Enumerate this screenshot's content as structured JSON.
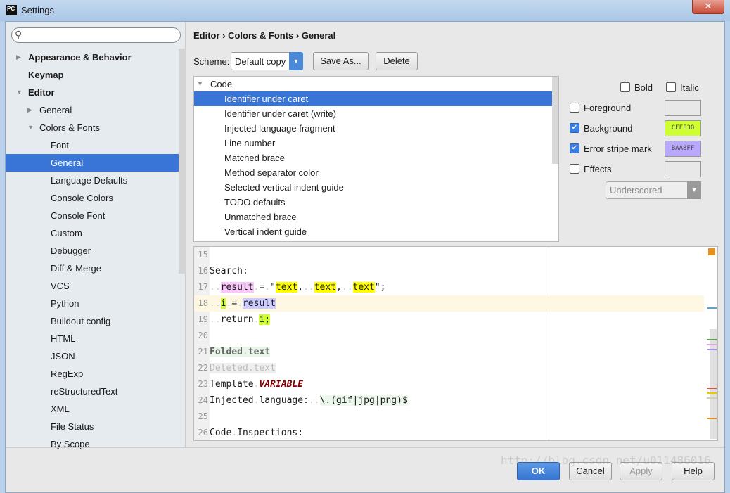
{
  "window": {
    "title": "Settings",
    "logo": "PC",
    "close": "✕"
  },
  "search": {
    "placeholder": "",
    "icon": "search-icon"
  },
  "tree": [
    {
      "label": "Appearance & Behavior",
      "level": 0,
      "bold": true,
      "arrow": "▶"
    },
    {
      "label": "Keymap",
      "level": 0,
      "bold": true,
      "arrow": ""
    },
    {
      "label": "Editor",
      "level": 0,
      "bold": true,
      "arrow": "▼"
    },
    {
      "label": "General",
      "level": 1,
      "arrow": "▶"
    },
    {
      "label": "Colors & Fonts",
      "level": 1,
      "arrow": "▼"
    },
    {
      "label": "Font",
      "level": 2
    },
    {
      "label": "General",
      "level": 2,
      "selected": true
    },
    {
      "label": "Language Defaults",
      "level": 2
    },
    {
      "label": "Console Colors",
      "level": 2
    },
    {
      "label": "Console Font",
      "level": 2
    },
    {
      "label": "Custom",
      "level": 2
    },
    {
      "label": "Debugger",
      "level": 2
    },
    {
      "label": "Diff & Merge",
      "level": 2
    },
    {
      "label": "VCS",
      "level": 2
    },
    {
      "label": "Python",
      "level": 2
    },
    {
      "label": "Buildout config",
      "level": 2
    },
    {
      "label": "HTML",
      "level": 2
    },
    {
      "label": "JSON",
      "level": 2
    },
    {
      "label": "RegExp",
      "level": 2
    },
    {
      "label": "reStructuredText",
      "level": 2
    },
    {
      "label": "XML",
      "level": 2
    },
    {
      "label": "File Status",
      "level": 2
    },
    {
      "label": "By Scope",
      "level": 2
    }
  ],
  "breadcrumb": "Editor › Colors & Fonts › General",
  "scheme": {
    "label": "Scheme:",
    "value": "Default copy",
    "save_as": "Save As...",
    "delete": "Delete"
  },
  "list": {
    "group": "Code",
    "items": [
      "Identifier under caret",
      "Identifier under caret (write)",
      "Injected language fragment",
      "Line number",
      "Matched brace",
      "Method separator color",
      "Selected vertical indent guide",
      "TODO defaults",
      "Unmatched brace",
      "Vertical indent guide"
    ],
    "selected": 0
  },
  "attrs": {
    "bold": "Bold",
    "italic": "Italic",
    "foreground": "Foreground",
    "background": "Background",
    "background_value": "CEFF30",
    "background_checked": true,
    "error_stripe": "Error stripe mark",
    "error_stripe_value": "BAA8FF",
    "error_stripe_checked": true,
    "effects": "Effects",
    "effect_type": "Underscored"
  },
  "editor": {
    "lines": [
      {
        "n": "15",
        "html": ""
      },
      {
        "n": "16",
        "html": "Search:"
      },
      {
        "n": "17",
        "html": "<span class=d>..</span><span style='background:#f8c8f8'>result</span><span class=d>.</span>=<span class=d>.</span>\"<span style='background:#ff0'>text</span>,<span class=d>..</span><span style='background:#ff0'>text</span>,<span class=d>..</span><span style='background:#ff0'>text</span>\";"
      },
      {
        "n": "18",
        "html": "<span class=d>..</span><span style='background:#ceff30'>i</span><span class=d>.</span>=<span class=d>.</span><span style='background:#ccccff'>result</span>",
        "cur": true
      },
      {
        "n": "19",
        "html": "<span class=d>..</span>return<span class=d>.</span><span style='background:#ceff30'>i;</span>"
      },
      {
        "n": "20",
        "html": ""
      },
      {
        "n": "21",
        "html": "<b style='background:#e8f5e8;color:#666'>Folded<span class=d>.</span>text</b>"
      },
      {
        "n": "22",
        "html": "<span style='background:#efefef;color:#bbb'>Deleted.text</span>"
      },
      {
        "n": "23",
        "html": "Template<span class=d>.</span><b><i style='color:#800000'>VARIABLE</i></b>"
      },
      {
        "n": "24",
        "html": "Injected<span class=d>.</span>language:<span class=d>..</span><span style='background:#edf8ec'>\\.(gif|jpg|png)$</span>"
      },
      {
        "n": "25",
        "html": ""
      },
      {
        "n": "26",
        "html": "Code<span class=d>.</span>Inspections:"
      }
    ]
  },
  "stripes": [
    "#e8901a",
    "#4da6dd",
    "#5a9e4a",
    "#e8a0e8",
    "#a090e8",
    "#d05050",
    "#e8c800",
    "#d8ccaa",
    "#e08a1a"
  ],
  "footer": {
    "ok": "OK",
    "cancel": "Cancel",
    "apply": "Apply",
    "help": "Help"
  },
  "watermark": "http://blog.csdn.net/u011486016"
}
